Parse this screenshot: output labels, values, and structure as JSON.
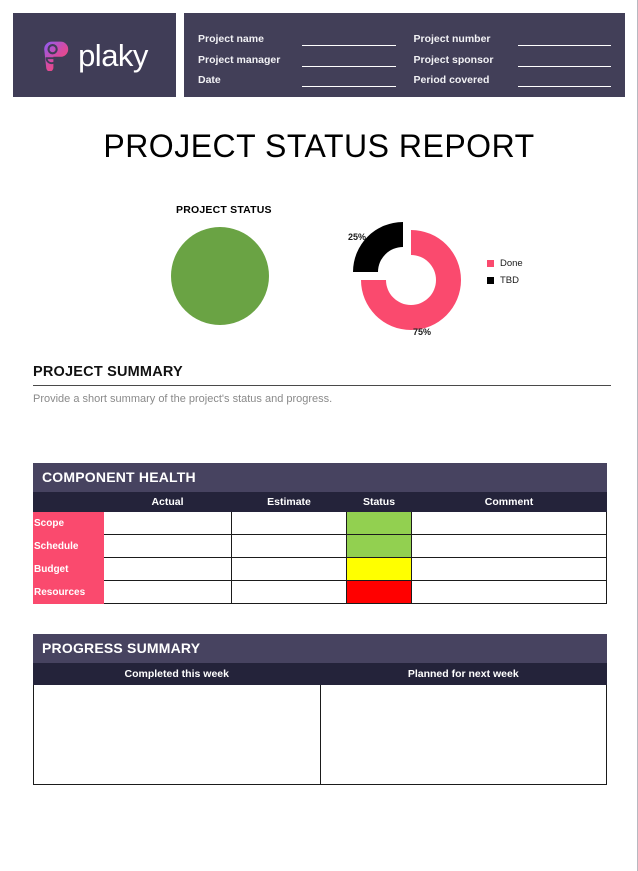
{
  "brand": {
    "name": "plaky",
    "logo_gradient_start": "#8B5CF6",
    "logo_gradient_end": "#FA4A6E",
    "header_bg": "#423F58"
  },
  "header": {
    "left_fields": [
      {
        "label": "Project name",
        "value": ""
      },
      {
        "label": "Project manager",
        "value": ""
      },
      {
        "label": "Date",
        "value": ""
      }
    ],
    "right_fields": [
      {
        "label": "Project number",
        "value": ""
      },
      {
        "label": "Project sponsor",
        "value": ""
      },
      {
        "label": "Period covered",
        "value": ""
      }
    ]
  },
  "title": "PROJECT STATUS REPORT",
  "charts": {
    "status_label": "PROJECT STATUS",
    "status_color": "#6AA344",
    "legend": [
      {
        "label": "Done",
        "color": "#FA4A6E"
      },
      {
        "label": "TBD",
        "color": "#000000"
      }
    ],
    "labels": {
      "tbd": "25%",
      "done": "75%"
    }
  },
  "chart_data": [
    {
      "type": "pie",
      "title": "PROJECT STATUS",
      "categories": [
        "Status"
      ],
      "values": [
        100
      ],
      "colors": [
        "#6AA344"
      ],
      "note": "Single solid green indicator circle"
    },
    {
      "type": "pie",
      "title": "",
      "subtype": "doughnut-exploded",
      "categories": [
        "Done",
        "TBD"
      ],
      "values": [
        75,
        25
      ],
      "colors": [
        "#FA4A6E",
        "#000000"
      ],
      "data_labels": [
        "75%",
        "25%"
      ],
      "legend_position": "right",
      "hole_ratio": 0.5,
      "exploded_slice": "TBD"
    }
  ],
  "project_summary": {
    "heading": "PROJECT SUMMARY",
    "placeholder": "Provide a short summary of the project's status and progress."
  },
  "component_health": {
    "title": "COMPONENT HEALTH",
    "columns": [
      "",
      "Actual",
      "Estimate",
      "Status",
      "Comment"
    ],
    "rows": [
      {
        "label": "Scope",
        "actual": "",
        "estimate": "",
        "status_color": "#92D050",
        "comment": ""
      },
      {
        "label": "Schedule",
        "actual": "",
        "estimate": "",
        "status_color": "#92D050",
        "comment": ""
      },
      {
        "label": "Budget",
        "actual": "",
        "estimate": "",
        "status_color": "#FFFF00",
        "comment": ""
      },
      {
        "label": "Resources",
        "actual": "",
        "estimate": "",
        "status_color": "#FF0000",
        "comment": ""
      }
    ]
  },
  "progress_summary": {
    "title": "PROGRESS SUMMARY",
    "columns": [
      "Completed this week",
      "Planned for next week"
    ],
    "cells": [
      "",
      ""
    ]
  }
}
